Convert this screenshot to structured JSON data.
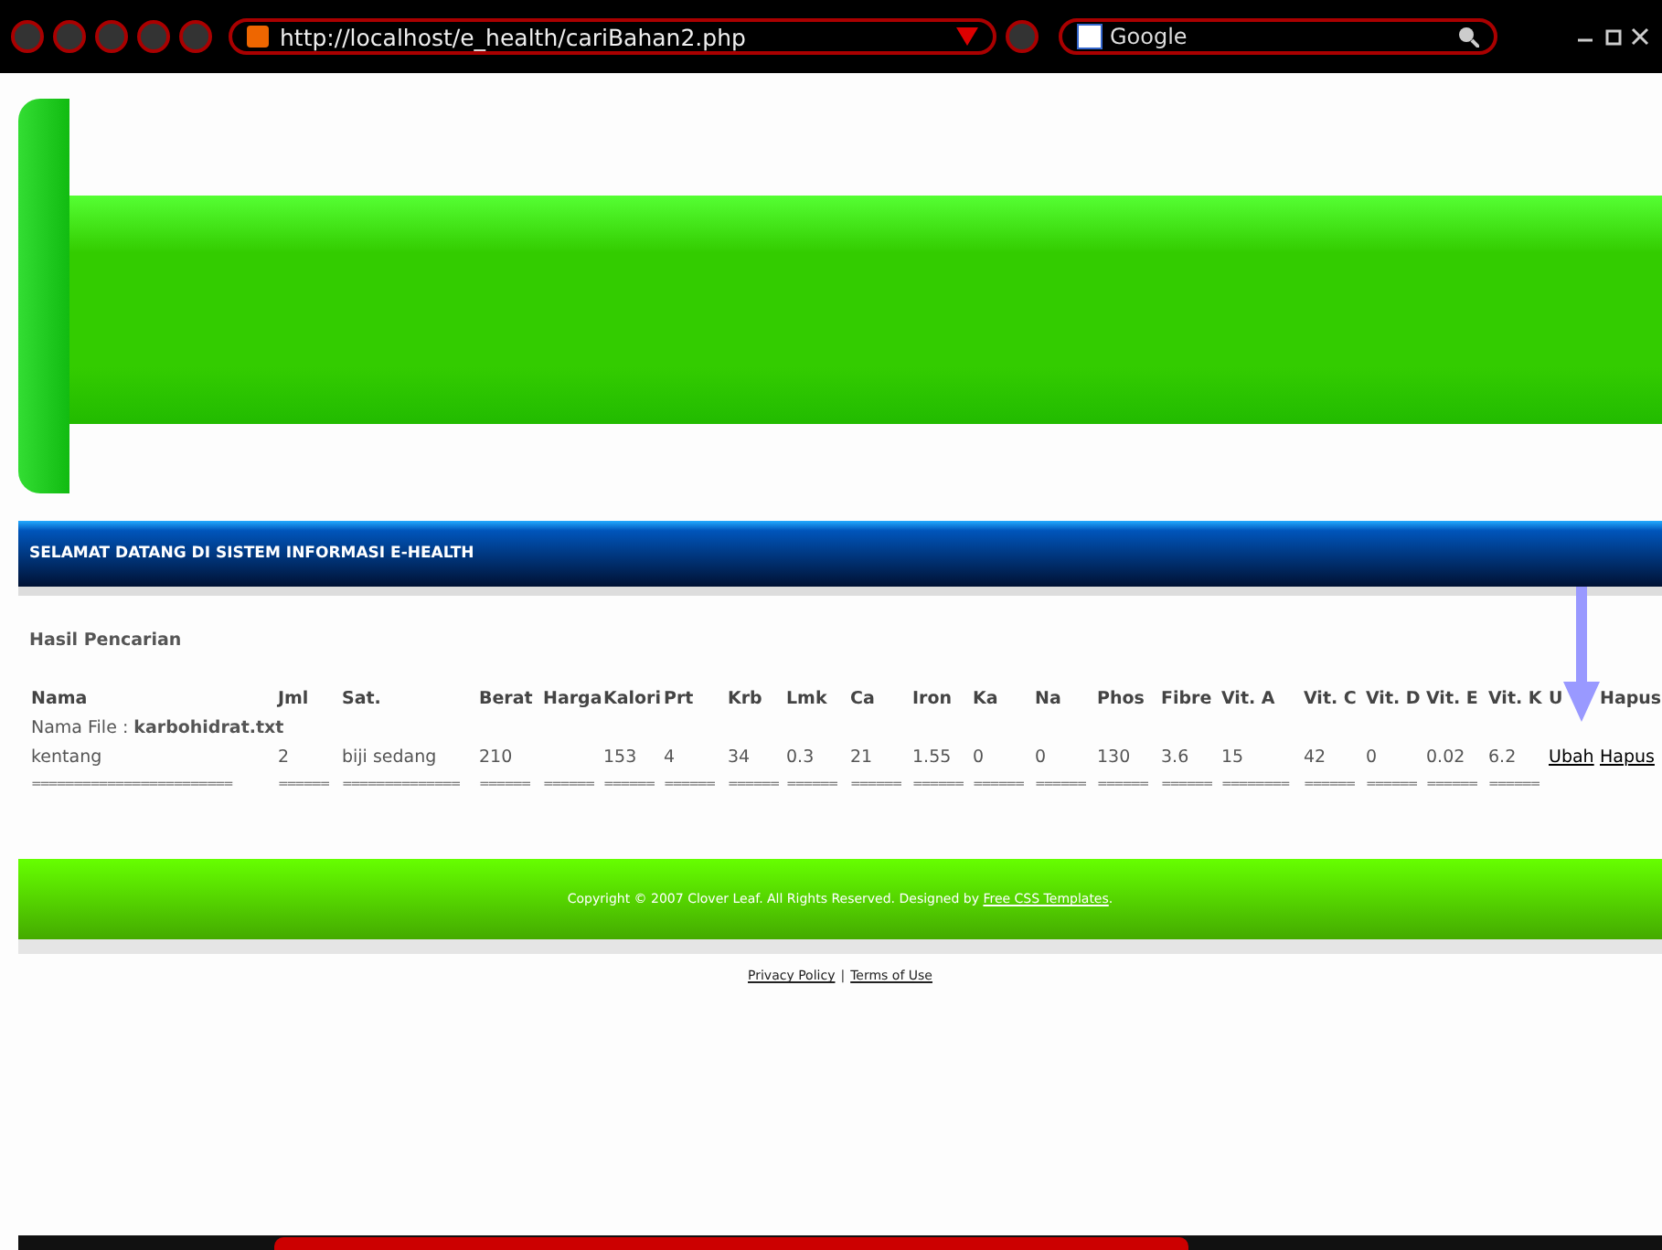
{
  "browser": {
    "url": "http://localhost/e_health/cariBahan2.php",
    "search_placeholder": "Google"
  },
  "welcome_bar": "SELAMAT DATANG DI SISTEM INFORMASI E-HEALTH",
  "section_title": "Hasil Pencarian",
  "table": {
    "columns": [
      "Nama",
      "Jml",
      "Sat.",
      "Berat",
      "Harga",
      "Kalori",
      "Prt",
      "Krb",
      "Lmk",
      "Ca",
      "Iron",
      "Ka",
      "Na",
      "Phos",
      "Fibre",
      "Vit. A",
      "Vit. C",
      "Vit. D",
      "Vit. E",
      "Vit. K",
      "U",
      "Hapus"
    ],
    "file_label": "Nama File : **karbohidrat.txt**",
    "rows": [
      {
        "cells": [
          "kentang",
          "2",
          "biji sedang",
          "210",
          "",
          "153",
          "4",
          "34",
          "0.3",
          "21",
          "1.55",
          "0",
          "0",
          "130",
          "3.6",
          "15",
          "42",
          "0",
          "0.02",
          "6.2"
        ],
        "links": [
          "Ubah",
          "Hapus"
        ]
      }
    ],
    "separators": [
      "========================",
      "======",
      "==============",
      "======",
      "======",
      "======",
      "======",
      "======",
      "======",
      "======",
      "======",
      "======",
      "======",
      "======",
      "======",
      "========",
      "======",
      "======",
      "======",
      "======"
    ]
  },
  "footer": {
    "copyright": "Copyright © 2007 Clover Leaf. All Rights Reserved. Designed by ",
    "credit_link": "Free CSS Templates",
    "credit_end": "."
  },
  "footer_links": [
    "Privacy Policy",
    "Terms of Use"
  ],
  "footer_link_separator": "|"
}
